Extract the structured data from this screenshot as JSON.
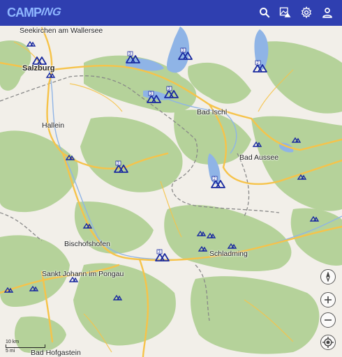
{
  "app": {
    "logo_text_a": "CAMP",
    "logo_text_b": "ING"
  },
  "toolbar": {
    "icons": [
      "search-icon",
      "mountain-map-icon",
      "gear-icon",
      "account-icon"
    ]
  },
  "map": {
    "places": [
      {
        "name": "Seekirchen am Wallersee",
        "key": "seekirchen"
      },
      {
        "name": "Salzburg",
        "key": "salzburg"
      },
      {
        "name": "Hallein",
        "key": "hallein"
      },
      {
        "name": "Bad Ischl",
        "key": "badischl"
      },
      {
        "name": "Bad Aussee",
        "key": "badaussee"
      },
      {
        "name": "Bischofshofen",
        "key": "bischofshofen"
      },
      {
        "name": "Schladming",
        "key": "schladming"
      },
      {
        "name": "Sankt Johann im Pongau",
        "key": "stjohann"
      },
      {
        "name": "Bad Hofgastein",
        "key": "badhofgastein"
      }
    ],
    "marker_badges": [
      "3",
      "3",
      "2",
      "3",
      "3",
      "3",
      "2",
      "3"
    ],
    "scale_km": "10 km",
    "scale_mi": "5 mi"
  },
  "colors": {
    "toolbar": "#2f3fb0",
    "forest": "#b5d29a",
    "water": "#8fb4e6",
    "road": "#f6c34a",
    "marker": "#1a2aa0"
  }
}
